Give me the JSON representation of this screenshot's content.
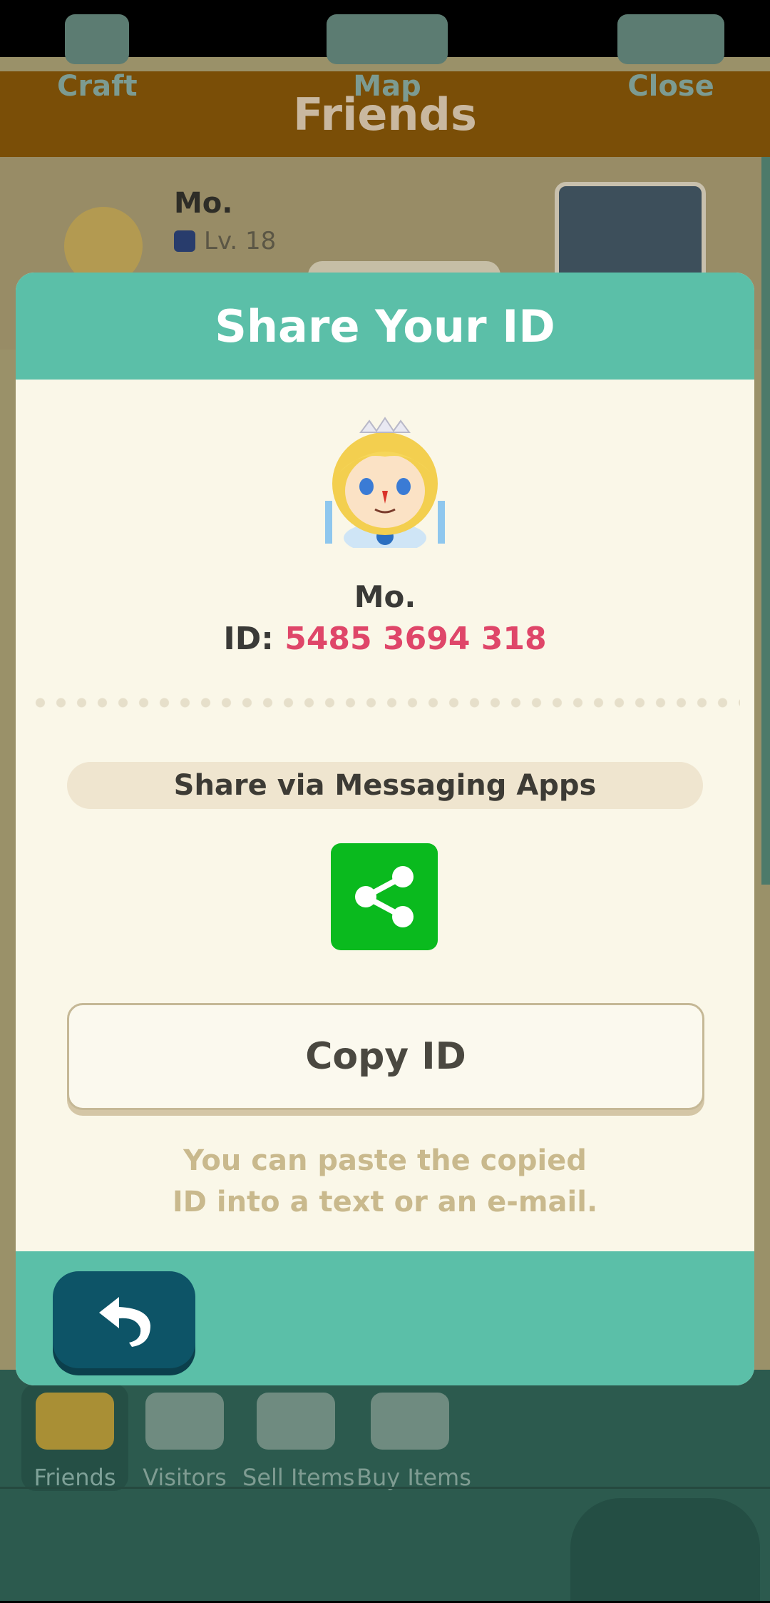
{
  "background": {
    "header_title": "Friends",
    "friend": {
      "name": "Mo.",
      "level": "Lv. 18"
    }
  },
  "dialog": {
    "title": "Share Your ID",
    "player_name": "Mo.",
    "id_label": "ID:",
    "id_value": "5485 3694 318",
    "share_section_label": "Share via Messaging Apps",
    "share_icon": "share-icon",
    "copy_button_label": "Copy ID",
    "hint_line1": "You can paste the copied",
    "hint_line2": "ID into a text or an e-mail.",
    "back_icon": "back-arrow-icon"
  },
  "nav": {
    "tabs": [
      {
        "label": "Friends",
        "active": true
      },
      {
        "label": "Visitors",
        "active": false
      },
      {
        "label": "Sell Items",
        "active": false
      },
      {
        "label": "Buy Items",
        "active": false
      }
    ],
    "bottom": [
      {
        "label": "Craft"
      },
      {
        "label": "Map"
      },
      {
        "label": "Close"
      }
    ]
  },
  "colors": {
    "accent_teal": "#5bbfa8",
    "id_value_color": "#df4669",
    "share_green": "#0aba1e",
    "back_button": "#0d5467"
  }
}
